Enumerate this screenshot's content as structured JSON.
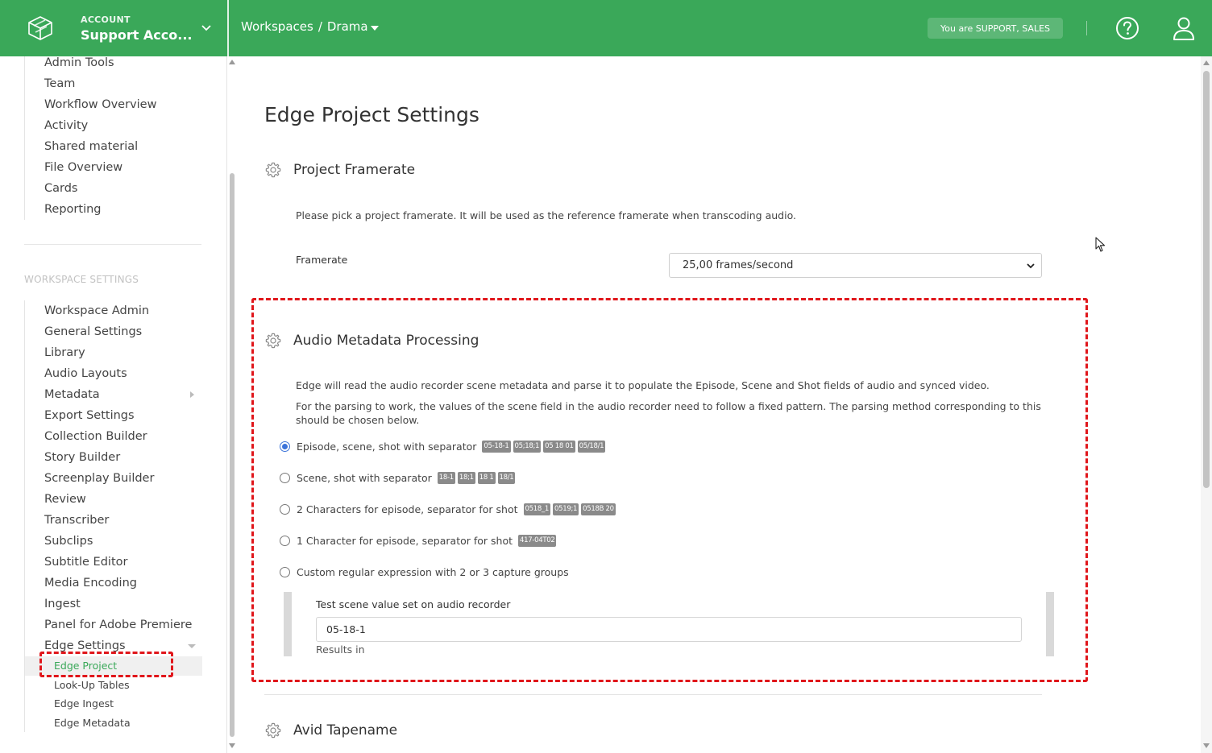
{
  "topbar": {
    "account_label": "ACCOUNT",
    "account_name": "Support Acco...",
    "breadcrumb_root": "Workspaces",
    "breadcrumb_sep": "/",
    "breadcrumb_current": "Drama",
    "role_badge": "You are SUPPORT, SALES",
    "brand_color": "#3aa859"
  },
  "sidebar": {
    "top_items": [
      "Admin Tools",
      "Team",
      "Workflow Overview",
      "Activity",
      "Shared material",
      "File Overview",
      "Cards",
      "Reporting"
    ],
    "workspace_heading": "WORKSPACE SETTINGS",
    "workspace_items": [
      "Workspace Admin",
      "General Settings",
      "Library",
      "Audio Layouts",
      "Metadata",
      "Export Settings",
      "Collection Builder",
      "Story Builder",
      "Screenplay Builder",
      "Review",
      "Transcriber",
      "Subclips",
      "Subtitle Editor",
      "Media Encoding",
      "Ingest",
      "Panel for Adobe Premiere",
      "Edge Settings"
    ],
    "edge_sub_items": [
      "Edge Project",
      "Look-Up Tables",
      "Edge Ingest",
      "Edge Metadata"
    ],
    "active_item": "Edge Project"
  },
  "main": {
    "page_title": "Edge Project Settings",
    "framerate_section": {
      "title": "Project Framerate",
      "description": "Please pick a project framerate. It will be used as the reference framerate when transcoding audio.",
      "field_label": "Framerate",
      "selected_value": "25,00 frames/second"
    },
    "audio_section": {
      "title": "Audio Metadata Processing",
      "description_1": "Edge will read the audio recorder scene metadata and parse it to populate the Episode, Scene and Shot fields of audio and synced video.",
      "description_2": "For the parsing to work, the values of the scene field in the audio recorder need to follow a fixed pattern. The parsing method corresponding to this should be chosen below.",
      "options": [
        {
          "label": "Episode, scene, shot with separator",
          "examples": [
            "05-18-1",
            "05;18;1",
            "05 18 01",
            "05/18/1"
          ],
          "selected": true
        },
        {
          "label": "Scene, shot with separator",
          "examples": [
            "18-1",
            "18;1",
            "18 1",
            "18/1"
          ],
          "selected": false
        },
        {
          "label": "2 Characters for episode, separator for shot",
          "examples": [
            "0518_1",
            "0519;1",
            "0518B 20"
          ],
          "selected": false
        },
        {
          "label": "1 Character for episode, separator for shot",
          "examples": [
            "417-04T02"
          ],
          "selected": false
        },
        {
          "label": "Custom regular expression with 2 or 3 capture groups",
          "examples": [],
          "selected": false
        }
      ],
      "test_label": "Test scene value set on audio recorder",
      "test_value": "05-18-1",
      "results_label": "Results in"
    },
    "tapename_section": {
      "title": "Avid Tapename"
    }
  },
  "annotation_color": "#e0161b",
  "radio_color": "#3b73d9"
}
